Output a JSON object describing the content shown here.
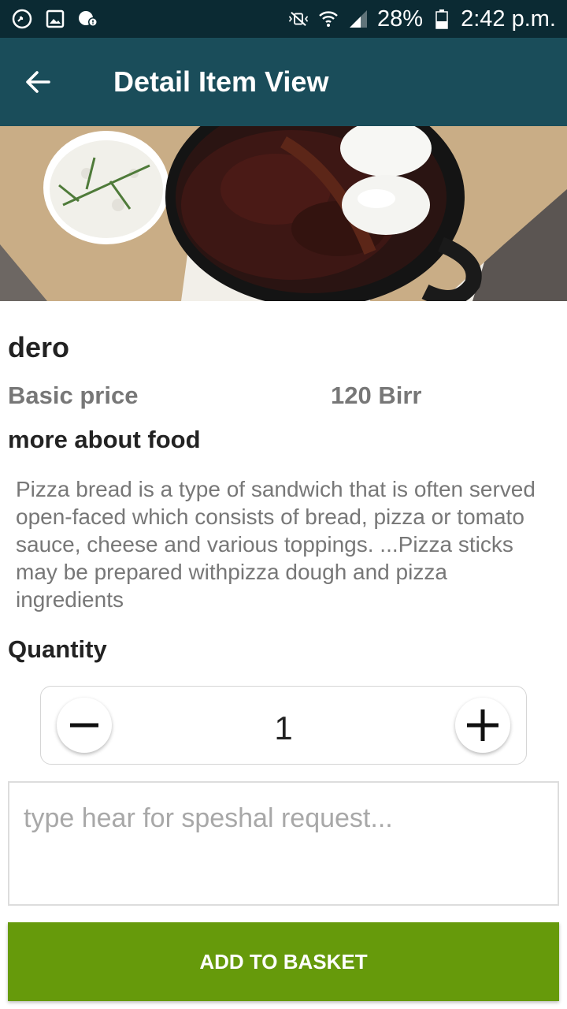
{
  "status_bar": {
    "battery": "28%",
    "time": "2:42 p.m."
  },
  "app_bar": {
    "title": "Detail Item View"
  },
  "item": {
    "name": "dero",
    "price_label": "Basic price",
    "price_value": "120 Birr",
    "more_label": "more about food",
    "description": "Pizza bread is a type of sandwich that is often served open-faced which consists of bread, pizza or tomato sauce, cheese and various toppings. ...Pizza sticks may be prepared withpizza dough and pizza ingredients"
  },
  "quantity": {
    "label": "Quantity",
    "value": "1"
  },
  "request": {
    "placeholder": "type hear for speshal request..."
  },
  "actions": {
    "add_to_basket": "ADD TO BASKET"
  },
  "colors": {
    "status_bar": "#0b2a33",
    "app_bar": "#1a4d5a",
    "add_button": "#669a0b"
  }
}
